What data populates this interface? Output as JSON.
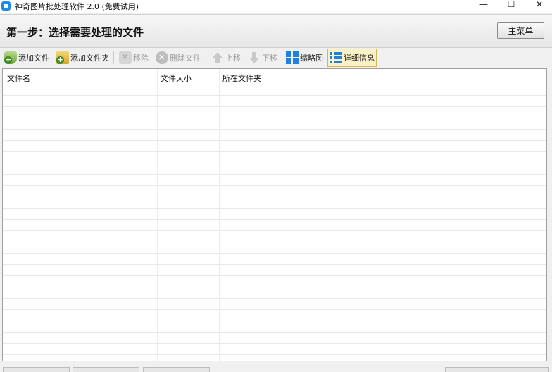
{
  "window": {
    "title": "神奇图片批处理软件 2.0 (免费试用)",
    "minimize_symbol": "—",
    "maximize_symbol": "☐",
    "close_symbol": "✕"
  },
  "header": {
    "step_title": "第一步：选择需要处理的文件",
    "main_menu_label": "主菜单"
  },
  "toolbar": {
    "add_file": "添加文件",
    "add_folder": "添加文件夹",
    "remove": "移除",
    "delete_file": "删除文件",
    "move_up": "上移",
    "move_down": "下移",
    "thumbnail": "缩略图",
    "details": "详细信息"
  },
  "file_list": {
    "columns": [
      "文件名",
      "文件大小",
      "所在文件夹"
    ],
    "rows": []
  },
  "colors": {
    "accent_blue": "#1f80e0",
    "active_view_bg": "#fbf1c6",
    "active_view_border": "#d6b45a"
  }
}
